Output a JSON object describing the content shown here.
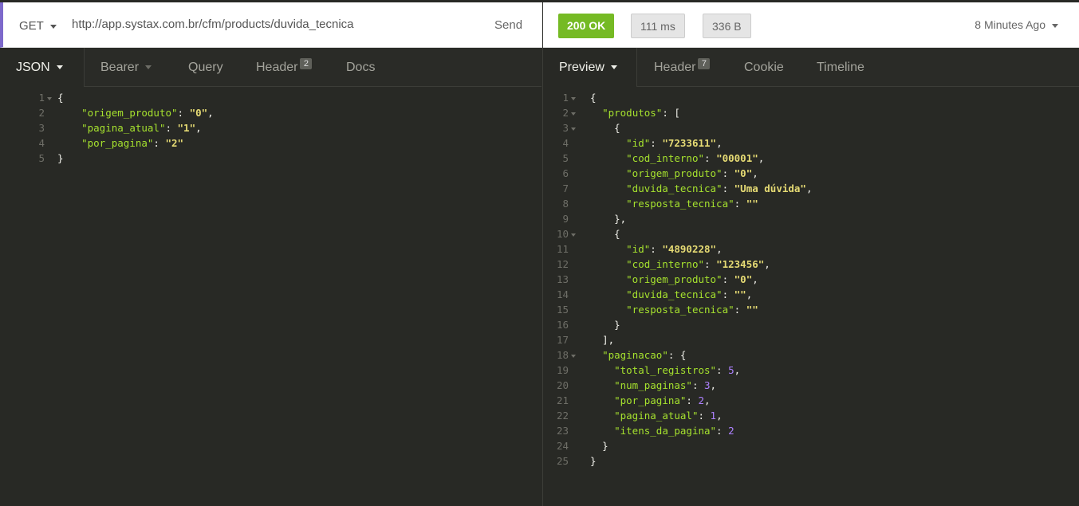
{
  "request": {
    "method": "GET",
    "url": "http://app.systax.com.br/cfm/products/duvida_tecnica",
    "send_label": "Send",
    "tabs": [
      {
        "label": "JSON"
      },
      {
        "label": "Bearer"
      },
      {
        "label": "Query"
      },
      {
        "label": "Header",
        "count": "2"
      },
      {
        "label": "Docs"
      }
    ],
    "body_lines": [
      "{",
      "    \"origem_produto\": \"0\",",
      "    \"pagina_atual\": \"1\",",
      "    \"por_pagina\": \"2\"",
      "}"
    ],
    "folds": [
      1
    ]
  },
  "response": {
    "status": "200 OK",
    "time": "111 ms",
    "size": "336 B",
    "history_label": "8 Minutes Ago",
    "tabs": [
      {
        "label": "Preview"
      },
      {
        "label": "Header",
        "count": "7"
      },
      {
        "label": "Cookie"
      },
      {
        "label": "Timeline"
      }
    ],
    "body_lines": [
      "{",
      "  \"produtos\": [",
      "    {",
      "      \"id\": \"7233611\",",
      "      \"cod_interno\": \"00001\",",
      "      \"origem_produto\": \"0\",",
      "      \"duvida_tecnica\": \"Uma dúvida\",",
      "      \"resposta_tecnica\": \"\"",
      "    },",
      "    {",
      "      \"id\": \"4890228\",",
      "      \"cod_interno\": \"123456\",",
      "      \"origem_produto\": \"0\",",
      "      \"duvida_tecnica\": \"\",",
      "      \"resposta_tecnica\": \"\"",
      "    }",
      "  ],",
      "  \"paginacao\": {",
      "    \"total_registros\": 5,",
      "    \"num_paginas\": 3,",
      "    \"por_pagina\": 2,",
      "    \"pagina_atual\": 1,",
      "    \"itens_da_pagina\": 2",
      "  }",
      "}"
    ],
    "folds": [
      1,
      2,
      3,
      10,
      18
    ]
  },
  "colors": {
    "accent": "#7d69cb",
    "status_ok": "#75ba24",
    "json_key": "#a6e22e",
    "json_string": "#e6db74",
    "json_number": "#ae81ff"
  },
  "icons": {
    "method_dropdown": "chevron-down-icon",
    "history_dropdown": "chevron-down-icon",
    "fold": "fold-arrow-icon"
  }
}
